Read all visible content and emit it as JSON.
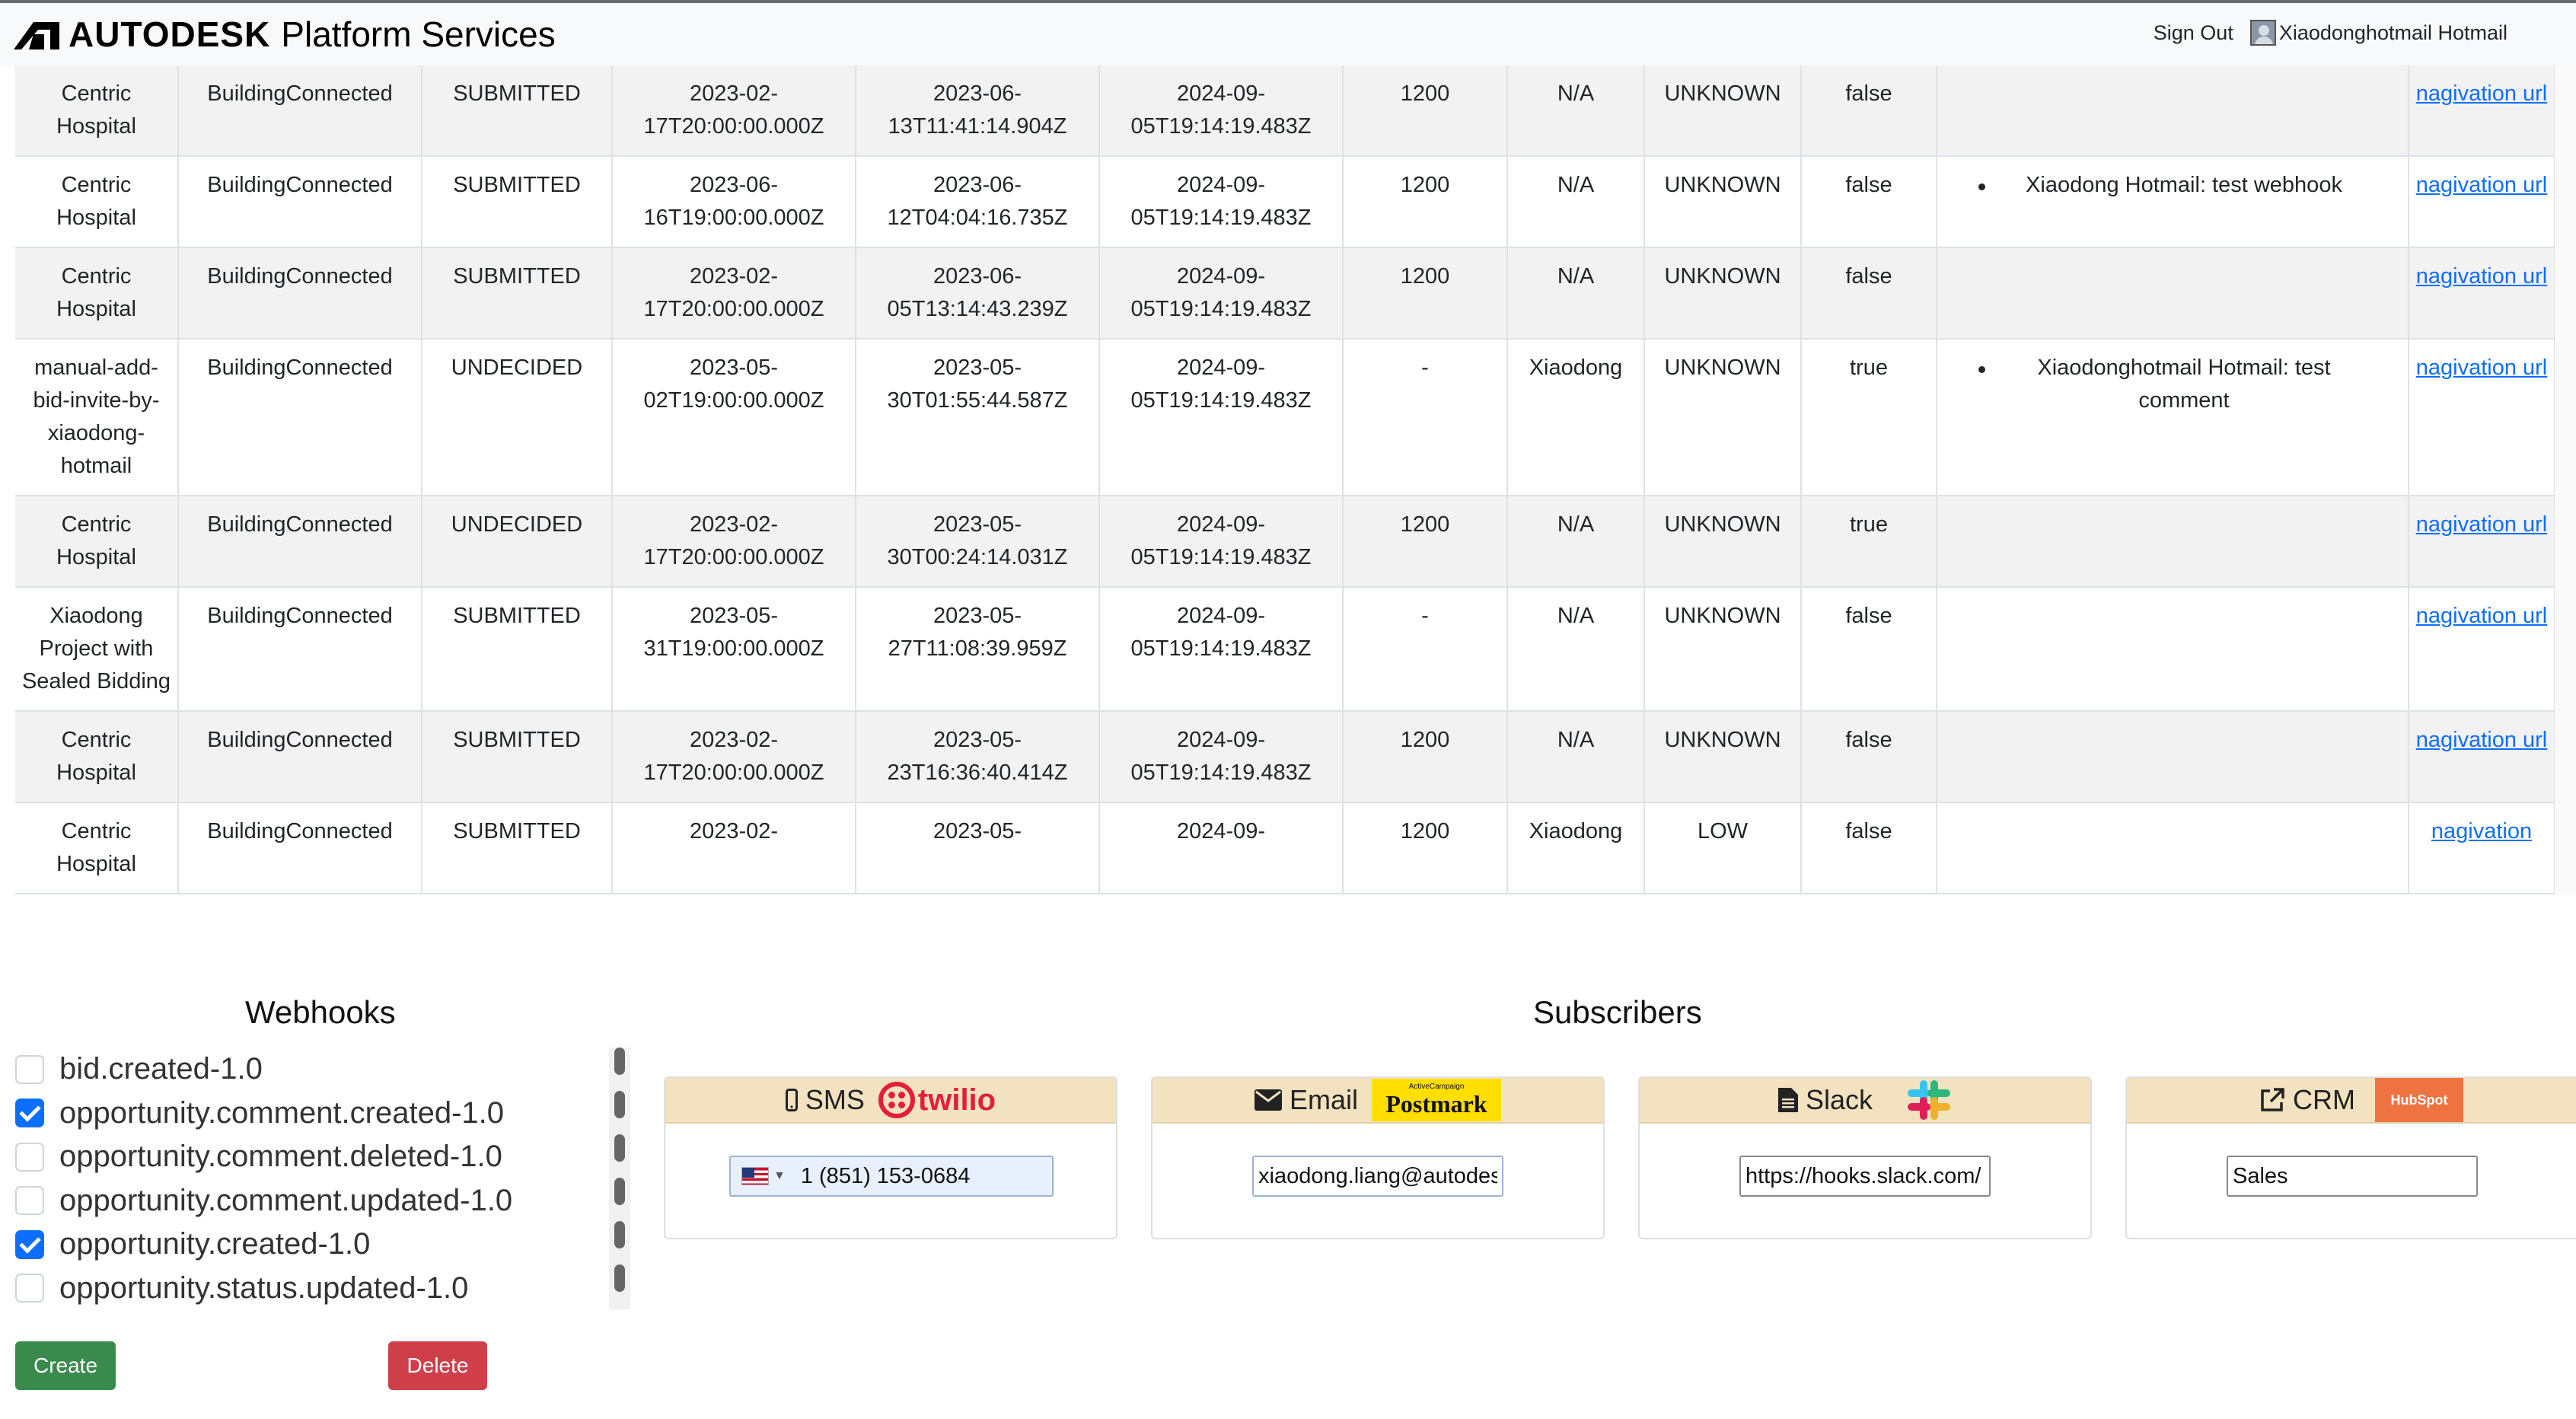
{
  "header": {
    "brand_bold": "AUTODESK",
    "brand_rest": "Platform Services",
    "sign_out": "Sign Out",
    "user_name": "Xiaodonghotmail Hotmail"
  },
  "table": {
    "rows": [
      {
        "project": "Centric Hospital",
        "source": "BuildingConnected",
        "state": "SUBMITTED",
        "due": "2023-02-17T20:00:00.000Z",
        "created": "2023-06-13T11:41:14.904Z",
        "updated": "2024-09-05T19:14:19.483Z",
        "size": "1200",
        "owner": "N/A",
        "priority": "UNKNOWN",
        "flag": "false",
        "comments": [],
        "link": "nagivation url",
        "striped": true
      },
      {
        "project": "Centric Hospital",
        "source": "BuildingConnected",
        "state": "SUBMITTED",
        "due": "2023-06-16T19:00:00.000Z",
        "created": "2023-06-12T04:04:16.735Z",
        "updated": "2024-09-05T19:14:19.483Z",
        "size": "1200",
        "owner": "N/A",
        "priority": "UNKNOWN",
        "flag": "false",
        "comments": [
          "Xiaodong Hotmail: test webhook"
        ],
        "link": "nagivation url",
        "striped": false
      },
      {
        "project": "Centric Hospital",
        "source": "BuildingConnected",
        "state": "SUBMITTED",
        "due": "2023-02-17T20:00:00.000Z",
        "created": "2023-06-05T13:14:43.239Z",
        "updated": "2024-09-05T19:14:19.483Z",
        "size": "1200",
        "owner": "N/A",
        "priority": "UNKNOWN",
        "flag": "false",
        "comments": [],
        "link": "nagivation url",
        "striped": true
      },
      {
        "project": "manual-add-bid-invite-by-xiaodong-hotmail",
        "source": "BuildingConnected",
        "state": "UNDECIDED",
        "due": "2023-05-02T19:00:00.000Z",
        "created": "2023-05-30T01:55:44.587Z",
        "updated": "2024-09-05T19:14:19.483Z",
        "size": "-",
        "owner": "Xiaodong",
        "priority": "UNKNOWN",
        "flag": "true",
        "comments": [
          "Xiaodonghotmail Hotmail: test comment"
        ],
        "link": "nagivation url",
        "striped": false
      },
      {
        "project": "Centric Hospital",
        "source": "BuildingConnected",
        "state": "UNDECIDED",
        "due": "2023-02-17T20:00:00.000Z",
        "created": "2023-05-30T00:24:14.031Z",
        "updated": "2024-09-05T19:14:19.483Z",
        "size": "1200",
        "owner": "N/A",
        "priority": "UNKNOWN",
        "flag": "true",
        "comments": [],
        "link": "nagivation url",
        "striped": true
      },
      {
        "project": "Xiaodong Project with Sealed Bidding",
        "source": "BuildingConnected",
        "state": "SUBMITTED",
        "due": "2023-05-31T19:00:00.000Z",
        "created": "2023-05-27T11:08:39.959Z",
        "updated": "2024-09-05T19:14:19.483Z",
        "size": "-",
        "owner": "N/A",
        "priority": "UNKNOWN",
        "flag": "false",
        "comments": [],
        "link": "nagivation url",
        "striped": false
      },
      {
        "project": "Centric Hospital",
        "source": "BuildingConnected",
        "state": "SUBMITTED",
        "due": "2023-02-17T20:00:00.000Z",
        "created": "2023-05-23T16:36:40.414Z",
        "updated": "2024-09-05T19:14:19.483Z",
        "size": "1200",
        "owner": "N/A",
        "priority": "UNKNOWN",
        "flag": "false",
        "comments": [],
        "link": "nagivation url",
        "striped": true
      },
      {
        "project": "Centric Hospital",
        "source": "BuildingConnected",
        "state": "SUBMITTED",
        "due": "2023-02-",
        "created": "2023-05-",
        "updated": "2024-09-",
        "size": "1200",
        "owner": "Xiaodong",
        "priority": "LOW",
        "flag": "false",
        "comments": [],
        "link": "nagivation",
        "striped": false
      }
    ]
  },
  "webhooks": {
    "title": "Webhooks",
    "items": [
      {
        "label": "bid.created-1.0",
        "checked": false
      },
      {
        "label": "opportunity.comment.created-1.0",
        "checked": true
      },
      {
        "label": "opportunity.comment.deleted-1.0",
        "checked": false
      },
      {
        "label": "opportunity.comment.updated-1.0",
        "checked": false
      },
      {
        "label": "opportunity.created-1.0",
        "checked": true
      },
      {
        "label": "opportunity.status.updated-1.0",
        "checked": false
      }
    ],
    "create_label": "Create",
    "delete_label": "Delete"
  },
  "subscribers": {
    "title": "Subscribers",
    "sms": {
      "label": "SMS",
      "logo": "twilio",
      "phone": "1 (851) 153-0684"
    },
    "email": {
      "label": "Email",
      "logo_small": "ActiveCampaign",
      "logo": "Postmark",
      "value": "xiaodong.liang@autodes"
    },
    "slack": {
      "label": "Slack",
      "value": "https://hooks.slack.com/"
    },
    "crm": {
      "label": "CRM",
      "logo": "HubSpot",
      "value": "Sales"
    }
  },
  "colors": {
    "link": "#0d6efd",
    "create": "#3a8a4d",
    "delete": "#cf3f4a",
    "card_header": "#f2e2bf",
    "twilio": "#e31e3a",
    "postmark": "#ffde00",
    "hubspot": "#ef7341"
  }
}
